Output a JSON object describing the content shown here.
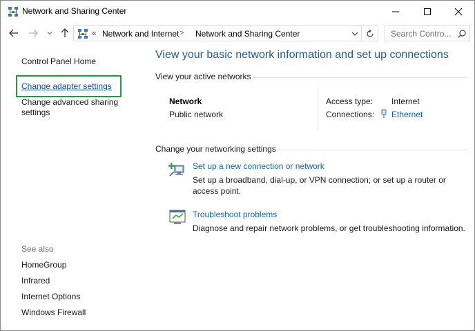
{
  "window": {
    "title": "Network and Sharing Center"
  },
  "address": {
    "overflow": "«",
    "segments": [
      "Network and Internet",
      "Network and Sharing Center"
    ],
    "separator": ">"
  },
  "search": {
    "placeholder": "Search Contro..."
  },
  "sidebar": {
    "home": "Control Panel Home",
    "adapter": "Change adapter settings",
    "advanced": "Change advanced sharing settings",
    "see_also": "See also",
    "see_also_items": [
      "HomeGroup",
      "Infrared",
      "Internet Options",
      "Windows Firewall"
    ]
  },
  "main": {
    "title": "View your basic network information and set up connections",
    "active_networks_heading": "View your active networks",
    "network": {
      "name": "Network",
      "type": "Public network",
      "access_type_label": "Access type:",
      "access_type_value": "Internet",
      "connections_label": "Connections:",
      "connections_value": "Ethernet"
    },
    "change_heading": "Change your networking settings",
    "tasks": [
      {
        "link": "Set up a new connection or network",
        "description": "Set up a broadband, dial-up, or VPN connection; or set up a router or access point."
      },
      {
        "link": "Troubleshoot problems",
        "description": "Diagnose and repair network problems, or get troubleshooting information."
      }
    ]
  },
  "colors": {
    "link": "#0a64c0",
    "title": "#1e5ba7",
    "highlight_box": "#1d9e3a"
  }
}
